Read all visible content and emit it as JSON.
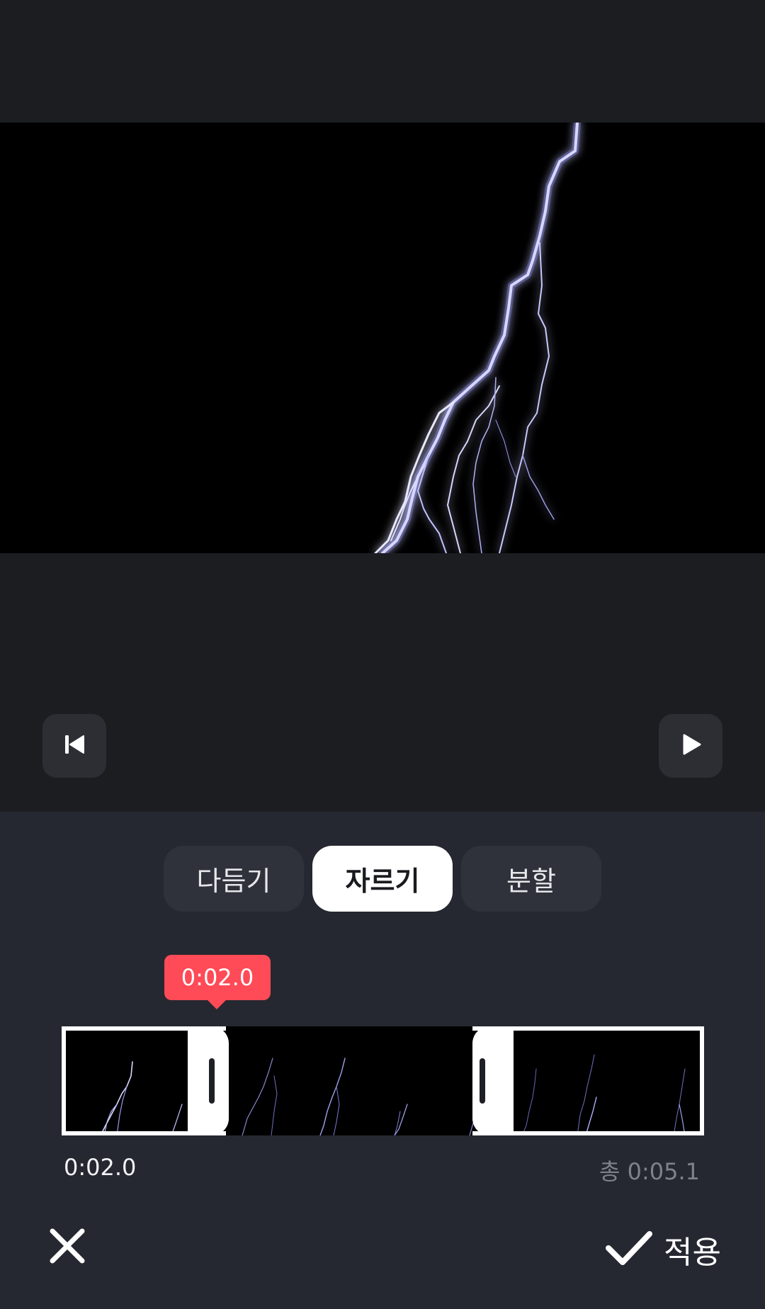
{
  "player": {
    "icons": {
      "restart": "skip-to-start-icon",
      "play": "play-icon"
    }
  },
  "editor": {
    "tabs": [
      {
        "label": "다듬기",
        "active": false
      },
      {
        "label": "자르기",
        "active": true
      },
      {
        "label": "분할",
        "active": false
      }
    ],
    "playhead_time": "0:02.0",
    "selection_start": "0:02.0",
    "total_duration": "총 0:05.1",
    "apply_label": "적용",
    "icons": {
      "close": "close-icon",
      "apply": "checkmark-icon"
    }
  },
  "colors": {
    "accent": "#ff4a57",
    "panel_bg": "#252830",
    "tab_active_bg": "#ffffff",
    "tab_bg": "#2f323a"
  }
}
